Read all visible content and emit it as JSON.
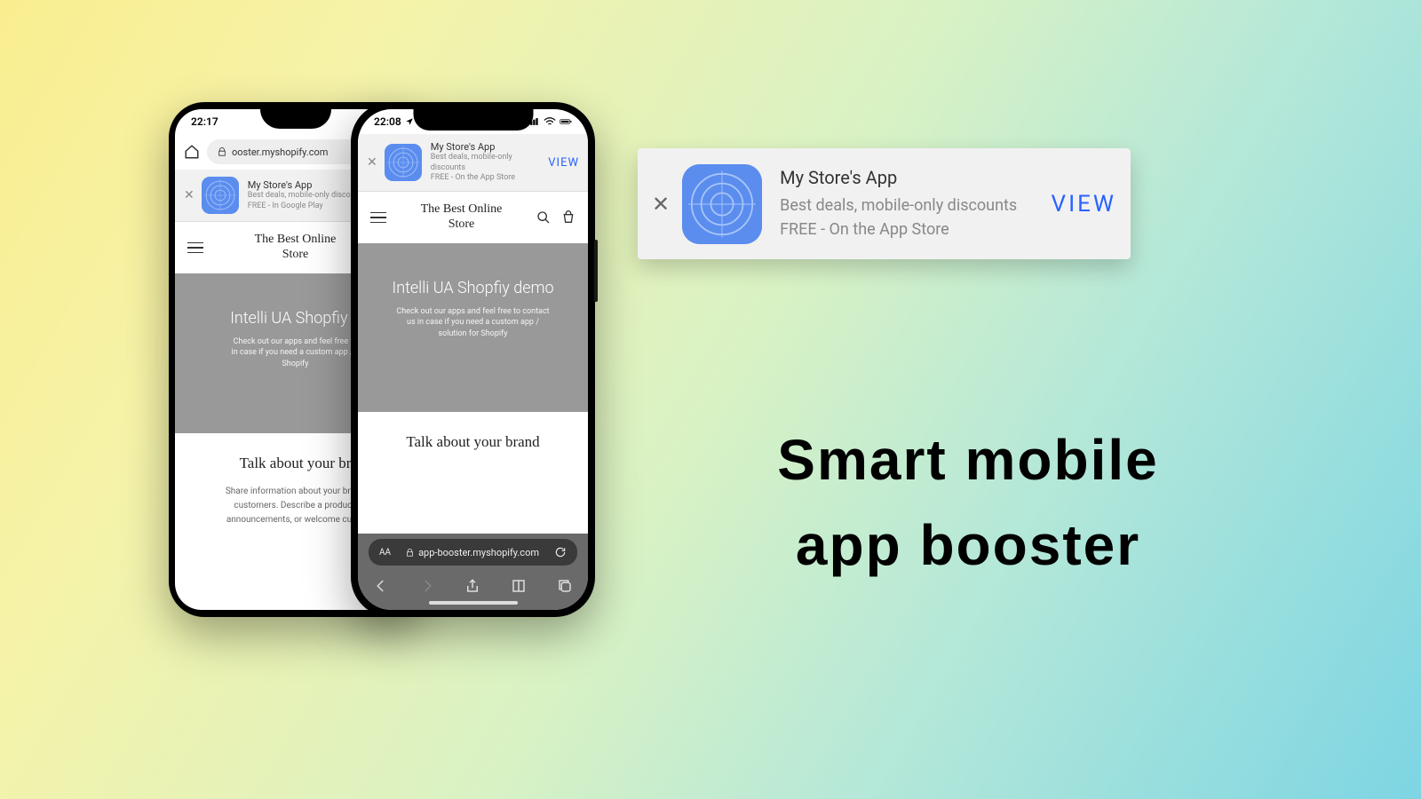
{
  "headline": {
    "line1": "Smart mobile",
    "line2": "app booster"
  },
  "standalone_banner": {
    "title": "My Store's App",
    "subtitle_line1": "Best deals, mobile-only discounts",
    "subtitle_line2": "FREE - On the App Store",
    "view": "VIEW"
  },
  "android": {
    "time": "22:17",
    "url": "ooster.myshopify.com",
    "banner": {
      "title": "My Store's App",
      "subtitle": "Best deals, mobile-only discounts",
      "free_line": "FREE - In Google Play"
    },
    "store_title_l1": "The Best Online",
    "store_title_l2": "Store",
    "hero_title": "Intelli UA Shopfiy d",
    "hero_sub_l1": "Check out our apps and feel free to",
    "hero_sub_l2": "in case if you need a custom app / s",
    "hero_sub_l3": "Shopify",
    "brand_title": "Talk about your br",
    "brand_text_l1": "Share information about your brand",
    "brand_text_l2": "customers. Describe a product,",
    "brand_text_l3": "announcements, or welcome custo"
  },
  "ios": {
    "time": "22:08",
    "banner": {
      "title": "My Store's App",
      "subtitle": "Best deals, mobile-only discounts",
      "free_line": "FREE - On the App Store",
      "view": "VIEW"
    },
    "store_title_l1": "The Best Online",
    "store_title_l2": "Store",
    "hero_title": "Intelli UA Shopfiy demo",
    "hero_sub_l1": "Check out our apps and feel free to contact",
    "hero_sub_l2": "us in case if you need a custom app /",
    "hero_sub_l3": "solution for Shopify",
    "brand_title": "Talk about your brand",
    "url": "app-booster.myshopify.com",
    "aa": "AA"
  }
}
